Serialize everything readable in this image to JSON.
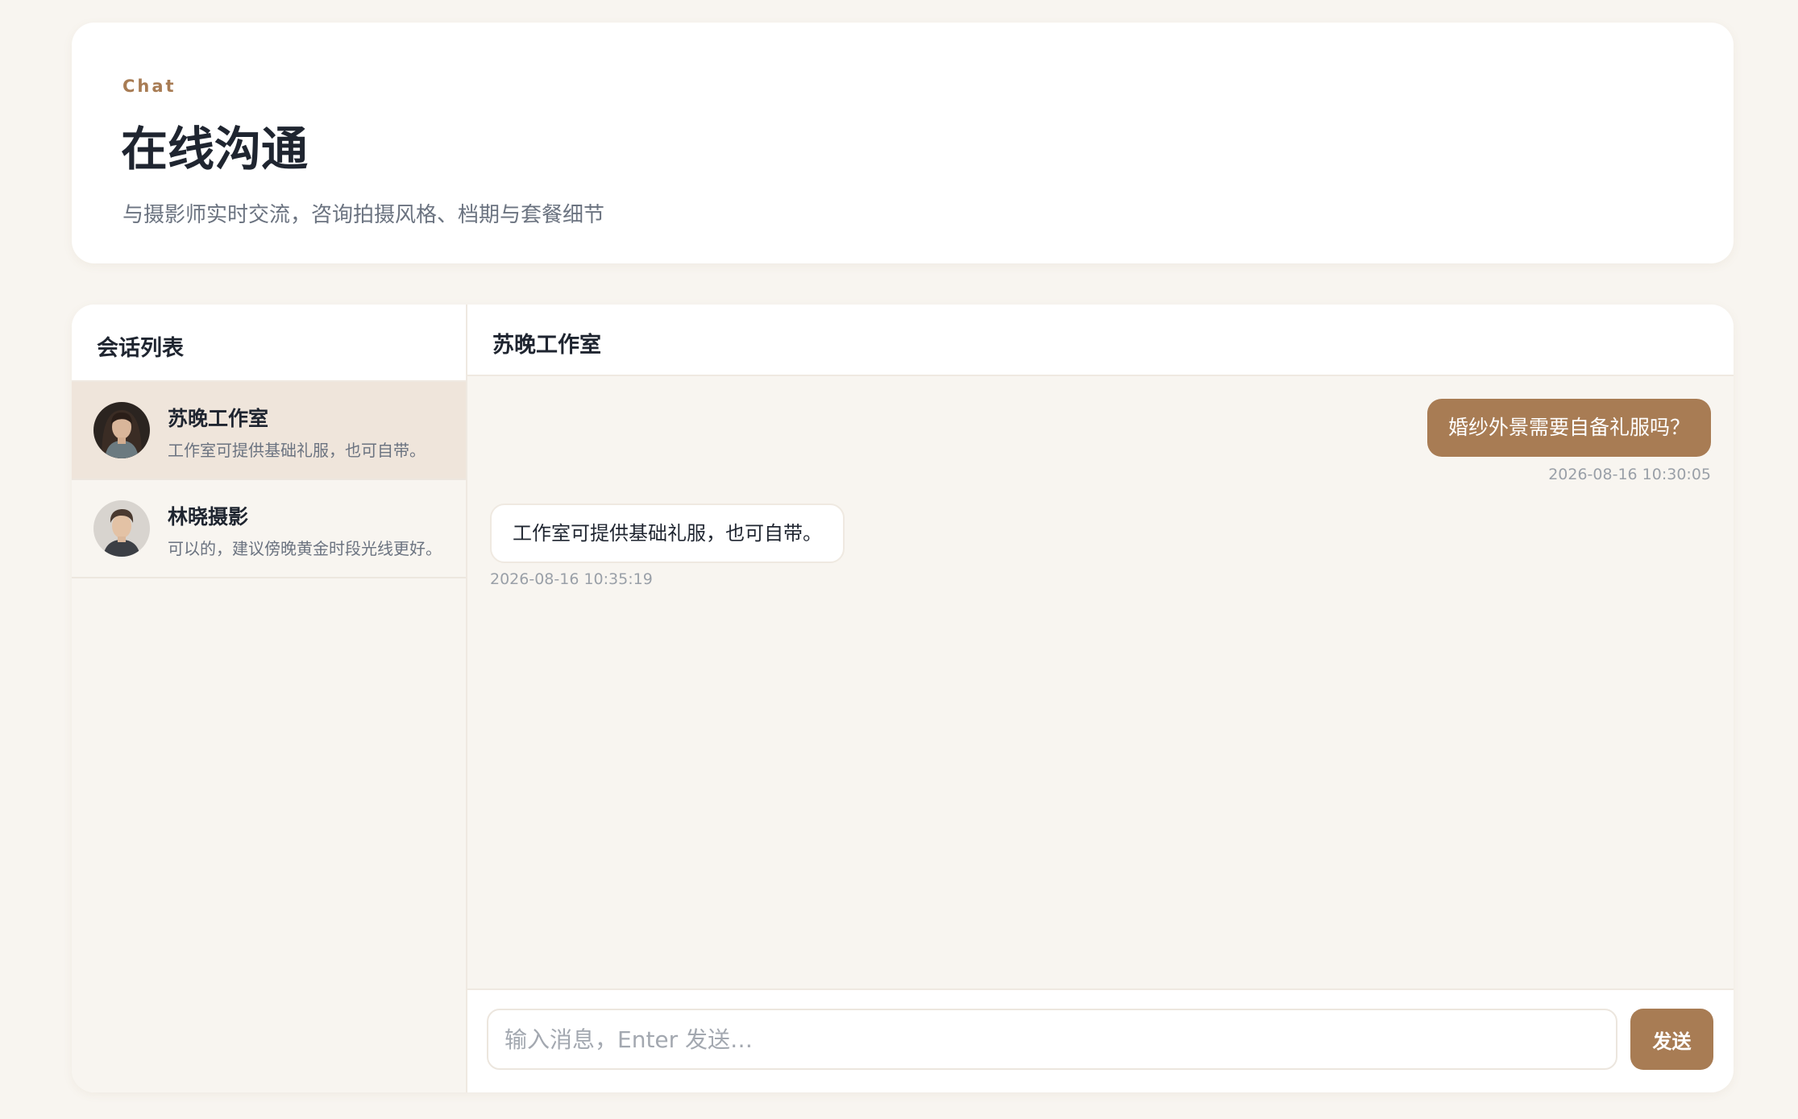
{
  "header": {
    "eyebrow": "Chat",
    "title": "在线沟通",
    "subtitle": "与摄影师实时交流，咨询拍摄风格、档期与套餐细节"
  },
  "sidebar": {
    "title": "会话列表",
    "conversations": [
      {
        "name": "苏晚工作室",
        "preview": "工作室可提供基础礼服，也可自带。",
        "avatar": "female-portrait-avatar",
        "active": true
      },
      {
        "name": "林晓摄影",
        "preview": "可以的，建议傍晚黄金时段光线更好。",
        "avatar": "male-portrait-avatar",
        "active": false
      }
    ]
  },
  "chat": {
    "title": "苏晚工作室",
    "messages": [
      {
        "direction": "outgoing",
        "text": "婚纱外景需要自备礼服吗？",
        "time": "2026-08-16 10:30:05"
      },
      {
        "direction": "incoming",
        "text": "工作室可提供基础礼服，也可自带。",
        "time": "2026-08-16 10:35:19"
      }
    ],
    "composer": {
      "placeholder": "输入消息，Enter 发送…",
      "value": "",
      "send_label": "发送"
    }
  },
  "colors": {
    "accent": "#a87c54",
    "page_background": "#f8f5f0",
    "active_conversation": "#efe5db",
    "text_primary": "#1f2530",
    "text_secondary": "#6b7380",
    "timestamp": "#9aa0a8"
  }
}
